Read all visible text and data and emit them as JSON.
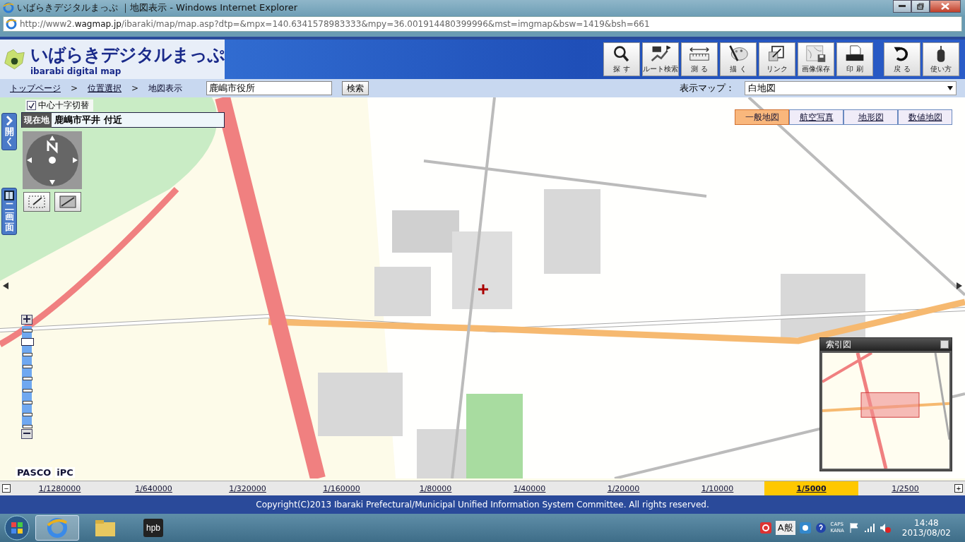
{
  "window": {
    "title": "いばらきデジタルまっぷ ｜地図表示 - Windows Internet Explorer"
  },
  "address_bar": {
    "url": "http://www2.**wagmap.jp**/ibaraki/map/map.asp?dtp=&mpx=140.6341578983333&mpy=36.001914480399996&mst=imgmap&bsw=1419&bsh=661"
  },
  "logo": {
    "title": "いばらきデジタルまっぷ",
    "subtitle": "ibarabi digital map"
  },
  "toolbar": [
    {
      "label": "探 す",
      "kind": "search"
    },
    {
      "label": "ルート検索",
      "kind": "route"
    },
    {
      "label": "測 る",
      "kind": "measure"
    },
    {
      "label": "描 く",
      "kind": "draw"
    },
    {
      "label": "リンク",
      "kind": "link"
    },
    {
      "label": "画像保存",
      "kind": "save"
    },
    {
      "label": "印 刷",
      "kind": "print"
    },
    {
      "label": "戻 る",
      "kind": "back"
    },
    {
      "label": "使い方",
      "kind": "help"
    }
  ],
  "breadcrumb": {
    "separator": ">",
    "items": [
      {
        "label": "トップページ",
        "link": true
      },
      {
        "label": "位置選択",
        "link": true
      },
      {
        "label": "地図表示",
        "link": false
      }
    ]
  },
  "search": {
    "value": "鹿嶋市役所",
    "button": "検索"
  },
  "map_select": {
    "label": "表示マップ：",
    "value": "白地図"
  },
  "map": {
    "crosshair_toggle": {
      "label": "中心十字切替",
      "checked": true
    },
    "location": {
      "label": "現在地",
      "value": "鹿嶋市平井 付近"
    },
    "side_tabs": [
      "開く",
      "二画面"
    ],
    "layer_tabs": [
      {
        "label": "一般地図",
        "selected": true
      },
      {
        "label": "航空写真",
        "selected": false
      },
      {
        "label": "地形図",
        "selected": false
      },
      {
        "label": "数値地図",
        "selected": false
      }
    ],
    "zoom_slider": {
      "level": 0.875
    },
    "logos": [
      "PASCO",
      "iPC"
    ],
    "index_map": {
      "title": "索引図"
    }
  },
  "scale_bar": {
    "zoom_out": "−",
    "zoom_in": "+",
    "items": [
      {
        "label": "1/1280000",
        "selected": false
      },
      {
        "label": "1/640000",
        "selected": false
      },
      {
        "label": "1/320000",
        "selected": false
      },
      {
        "label": "1/160000",
        "selected": false
      },
      {
        "label": "1/80000",
        "selected": false
      },
      {
        "label": "1/40000",
        "selected": false
      },
      {
        "label": "1/20000",
        "selected": false
      },
      {
        "label": "1/10000",
        "selected": false
      },
      {
        "label": "1/5000",
        "selected": true
      },
      {
        "label": "1/2500",
        "selected": false
      }
    ]
  },
  "copyright": "Copyright(C)2013 Ibaraki Prefectural/Municipal Unified Information System Committee. All rights reserved.",
  "taskbar": {
    "apps": [
      {
        "kind": "browser",
        "active": true
      },
      {
        "kind": "folder",
        "active": false
      },
      {
        "kind": "hpb",
        "label": "hpb",
        "active": false
      }
    ],
    "ime": "A般",
    "caps": "CAPS",
    "kana": "KANA",
    "time": "14:48",
    "date": "2013/08/02"
  }
}
